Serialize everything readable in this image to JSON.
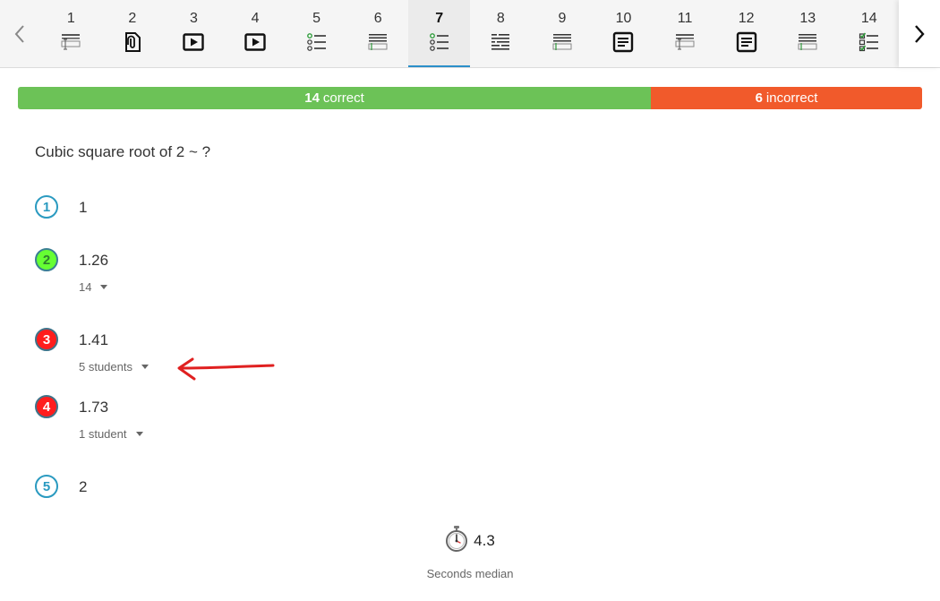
{
  "nav": {
    "items": [
      {
        "number": "1",
        "icon": "form-field-icon"
      },
      {
        "number": "2",
        "icon": "attachment-icon"
      },
      {
        "number": "3",
        "icon": "video-play-icon"
      },
      {
        "number": "4",
        "icon": "video-play-icon"
      },
      {
        "number": "5",
        "icon": "multiple-choice-icon"
      },
      {
        "number": "6",
        "icon": "text-entry-icon"
      },
      {
        "number": "7",
        "icon": "multiple-choice-icon",
        "active": true
      },
      {
        "number": "8",
        "icon": "ordering-icon"
      },
      {
        "number": "9",
        "icon": "text-entry-icon"
      },
      {
        "number": "10",
        "icon": "document-icon"
      },
      {
        "number": "11",
        "icon": "form-field-icon"
      },
      {
        "number": "12",
        "icon": "document-icon"
      },
      {
        "number": "13",
        "icon": "text-entry-icon"
      },
      {
        "number": "14",
        "icon": "checklist-icon"
      }
    ]
  },
  "results": {
    "correct_count": "14",
    "correct_word": "correct",
    "incorrect_count": "6",
    "incorrect_word": "incorrect",
    "correct_fraction": 0.7,
    "colors": {
      "correct": "#6cc257",
      "incorrect": "#f15a2b"
    }
  },
  "question": {
    "text": "Cubic square root of 2 ~ ?"
  },
  "options": [
    {
      "number": "1",
      "value": "1",
      "state": "neutral",
      "count": ""
    },
    {
      "number": "2",
      "value": "1.26",
      "state": "correct",
      "count": "14"
    },
    {
      "number": "3",
      "value": "1.41",
      "state": "wrong",
      "count": "5 students"
    },
    {
      "number": "4",
      "value": "1.73",
      "state": "wrong",
      "count": "1 student"
    },
    {
      "number": "5",
      "value": "2",
      "state": "neutral",
      "count": ""
    }
  ],
  "median": {
    "icon": "stopwatch-icon",
    "value": "4.3",
    "label": "Seconds median"
  }
}
